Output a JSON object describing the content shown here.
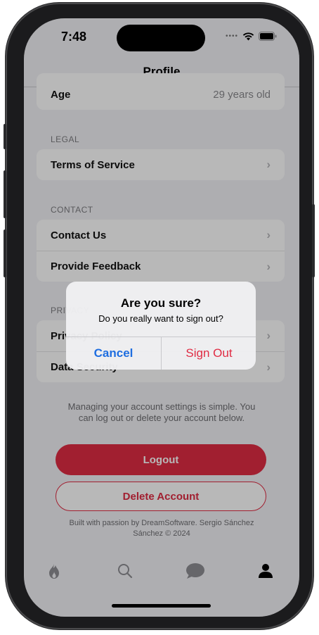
{
  "status": {
    "time": "7:48"
  },
  "nav": {
    "title": "Profile"
  },
  "profile": {
    "age_label": "Age",
    "age_value": "29 years old"
  },
  "sections": {
    "legal": {
      "header": "LEGAL",
      "items": [
        {
          "label": "Terms of Service"
        }
      ]
    },
    "contact": {
      "header": "CONTACT",
      "items": [
        {
          "label": "Contact Us"
        },
        {
          "label": "Provide Feedback"
        }
      ]
    },
    "privacy": {
      "header": "PRIVACY",
      "items": [
        {
          "label": "Privacy Policy"
        },
        {
          "label": "Data Security"
        }
      ]
    }
  },
  "info_text": "Managing your account settings is simple. You can log out or delete your account below.",
  "buttons": {
    "logout": "Logout",
    "delete": "Delete Account"
  },
  "credits": "Built with passion by DreamSoftware. Sergio Sánchez Sánchez © 2024",
  "tabbar": {
    "items": [
      {
        "icon": "flame-icon"
      },
      {
        "icon": "search-icon"
      },
      {
        "icon": "chat-bubble-icon"
      },
      {
        "icon": "person-icon"
      }
    ]
  },
  "alert": {
    "title": "Are you sure?",
    "message": "Do you really want to sign out?",
    "cancel": "Cancel",
    "confirm": "Sign Out"
  },
  "colors": {
    "accent": "#e02b43",
    "link": "#1f6ee0"
  }
}
